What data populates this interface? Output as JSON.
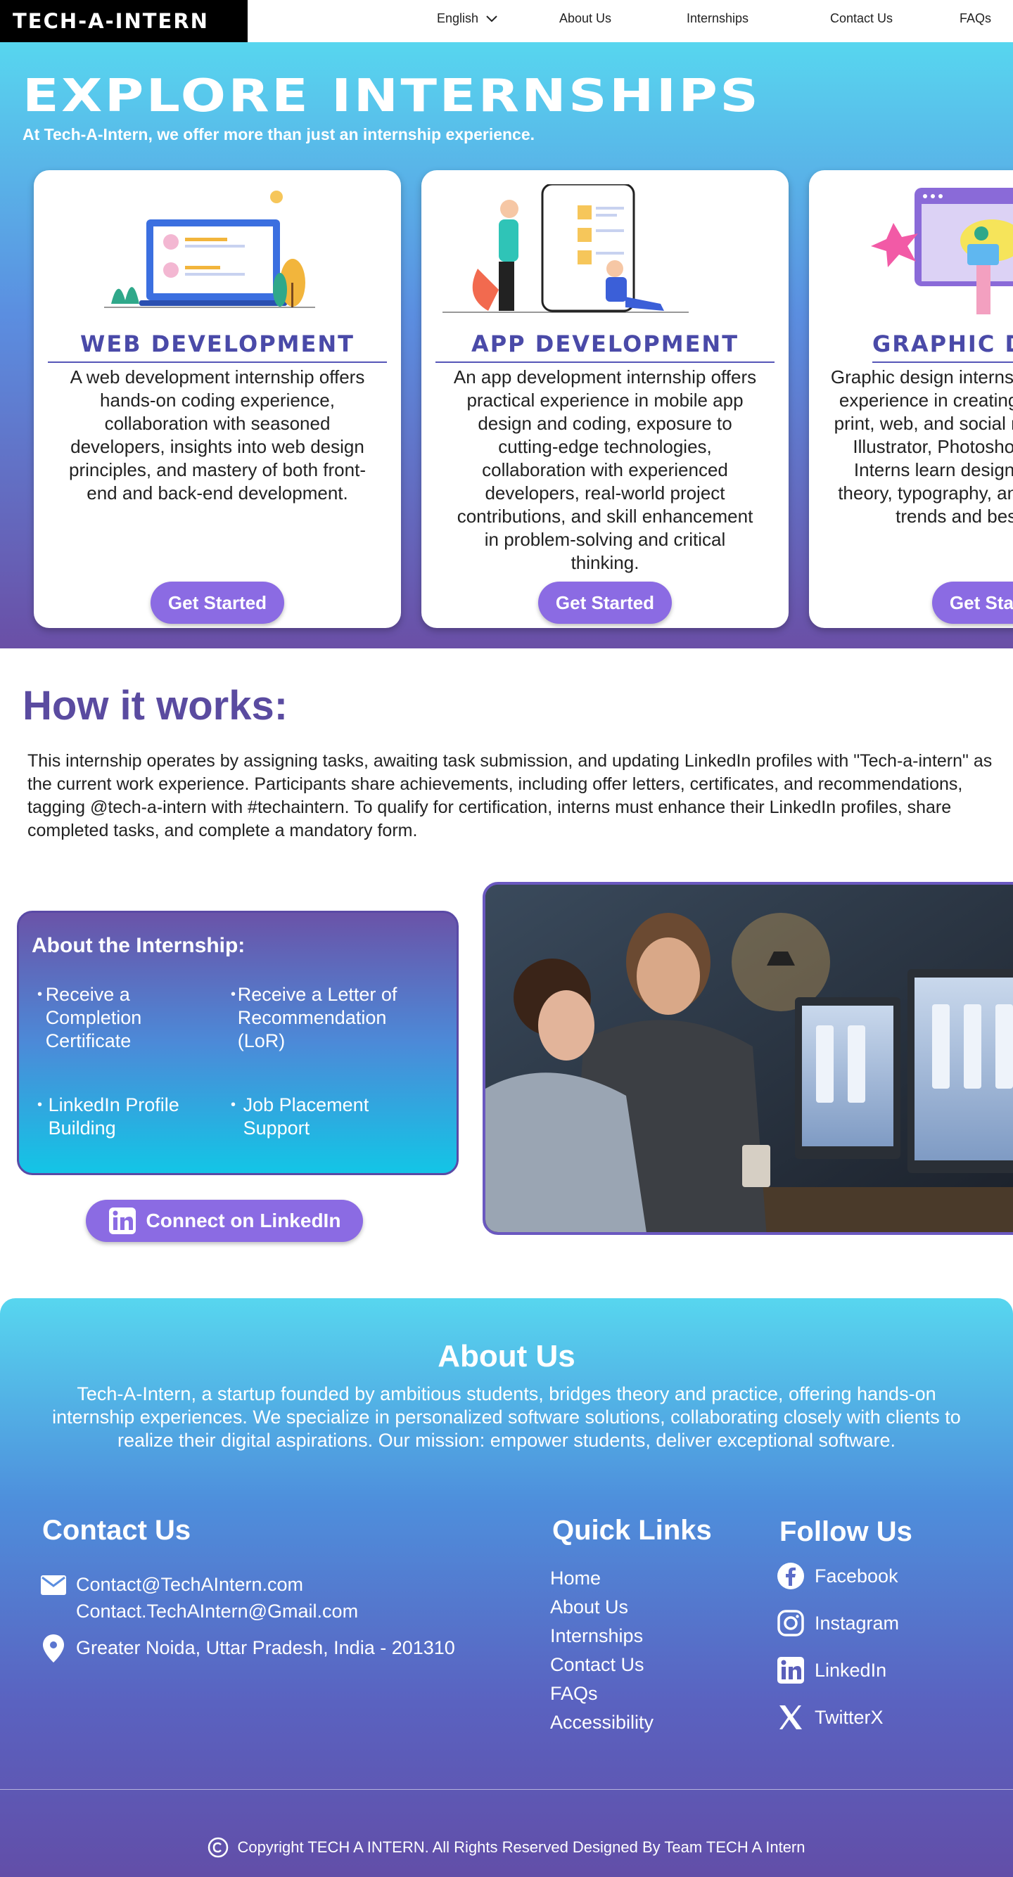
{
  "nav": {
    "logo": "TECH-A-INTERN",
    "language": "English",
    "items": [
      "About Us",
      "Internships",
      "Contact Us",
      "FAQs"
    ]
  },
  "hero": {
    "title": "Explore Internships",
    "subtitle": "At Tech-A-Intern, we offer more than just an internship experience.",
    "cards": [
      {
        "title": "Web Development",
        "description": "A web development internship offers hands-on coding experience, collaboration with seasoned developers, insights into web design principles, and mastery of both front-end and back-end development.",
        "button": "Get Started"
      },
      {
        "title": "App Development",
        "description": "An app development internship offers practical experience in mobile app design and coding, exposure to cutting-edge technologies, collaboration with experienced developers, real-world project contributions, and skill enhancement in problem-solving and critical thinking.",
        "button": "Get Started"
      },
      {
        "title": "Graphic Design",
        "description": "Graphic design internship offers hands-on experience in creating visual content for print, web, and social media using Adobe Illustrator, Photoshop, and InDesign. Interns learn design principles, color theory, typography, and stay updated on trends and best practices.",
        "button": "Get Started"
      }
    ]
  },
  "how": {
    "title": "How it works:",
    "text": "This internship operates by assigning tasks, awaiting task submission, and updating LinkedIn profiles with \"Tech-a-intern\" as the current work experience. Participants share achievements, including offer letters, certificates, and recommendations, tagging @tech-a-intern with #techaintern. To qualify for certification, interns must enhance their LinkedIn profiles, share completed tasks, and complete a mandatory form."
  },
  "about_internship": {
    "title": "About the Internship:",
    "items": [
      "Receive a Completion Certificate",
      "Receive a Letter of Recommendation (LoR)",
      "LinkedIn Profile Building",
      "Job Placement Support"
    ],
    "linkedin_button": "Connect on LinkedIn"
  },
  "footer": {
    "about_title": "About Us",
    "about_text": "Tech-A-Intern, a startup founded by ambitious students, bridges theory and practice, offering hands-on internship experiences. We specialize in personalized software solutions, collaborating closely with clients to realize their digital aspirations. Our mission: empower students, deliver exceptional software.",
    "contact_title": "Contact Us",
    "email1": "Contact@TechAIntern.com",
    "email2": "Contact.TechAIntern@Gmail.com",
    "address": "Greater Noida, Uttar Pradesh, India - 201310",
    "quick_title": "Quick Links",
    "quick_links": [
      "Home",
      "About Us",
      "Internships",
      "Contact Us",
      "FAQs",
      "Accessibility"
    ],
    "follow_title": "Follow Us",
    "social": [
      "Facebook",
      "Instagram",
      "LinkedIn",
      "TwitterX"
    ],
    "copyright": "Copyright TECH A INTERN. All Rights Reserved Designed By Team TECH A Intern"
  },
  "colors": {
    "accent": "#8b6be3",
    "title_purple": "#5a4ba0",
    "gradient_top": "#57d6ef",
    "gradient_bottom": "#6a4fa6"
  }
}
